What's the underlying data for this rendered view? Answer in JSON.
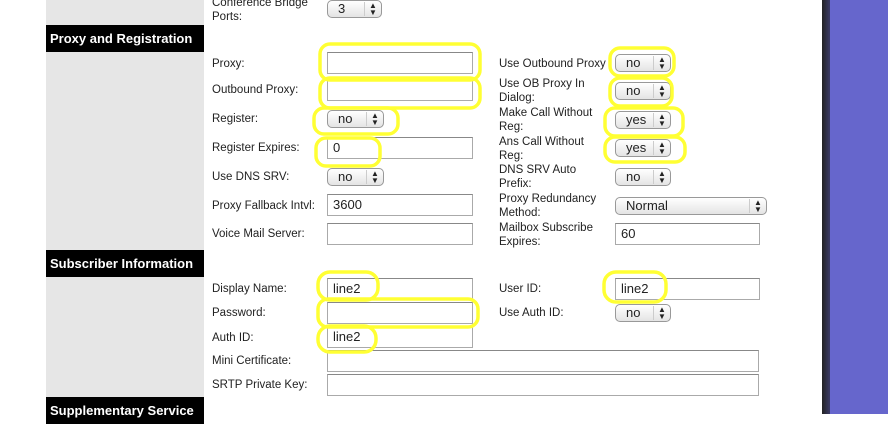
{
  "sections": {
    "proxy": "Proxy and Registration",
    "subscriber": "Subscriber Information",
    "supplementary": "Supplementary Service"
  },
  "fields": {
    "conf_bridge": {
      "label": "Conference Bridge Ports:",
      "value": "3"
    },
    "proxy": {
      "label": "Proxy:",
      "value": ""
    },
    "outbound_proxy": {
      "label": "Outbound Proxy:",
      "value": ""
    },
    "register": {
      "label": "Register:",
      "value": "no"
    },
    "register_expires": {
      "label": "Register Expires:",
      "value": "0"
    },
    "use_dns_srv": {
      "label": "Use DNS SRV:",
      "value": "no"
    },
    "proxy_fallback": {
      "label": "Proxy Fallback Intvl:",
      "value": "3600"
    },
    "voice_mail": {
      "label": "Voice Mail Server:",
      "value": ""
    },
    "use_outbound_proxy": {
      "label": "Use Outbound Proxy",
      "value": "no"
    },
    "use_ob_dialog": {
      "label": "Use OB Proxy In Dialog:",
      "value": "no"
    },
    "make_call": {
      "label": "Make Call Without Reg:",
      "value": "yes"
    },
    "ans_call": {
      "label": "Ans Call Without Reg:",
      "value": "yes"
    },
    "dns_srv_prefix": {
      "label": "DNS SRV Auto Prefix:",
      "value": "no"
    },
    "proxy_redundancy": {
      "label": "Proxy Redundancy Method:",
      "value": "Normal"
    },
    "mailbox_expires": {
      "label": "Mailbox Subscribe Expires:",
      "value": "60"
    },
    "display_name": {
      "label": "Display Name:",
      "value": "line2"
    },
    "password": {
      "label": "Password:",
      "value": ""
    },
    "auth_id": {
      "label": "Auth ID:",
      "value": "line2"
    },
    "mini_cert": {
      "label": "Mini Certificate:",
      "value": ""
    },
    "srtp_key": {
      "label": "SRTP Private Key:",
      "value": ""
    },
    "user_id": {
      "label": "User ID:",
      "value": "line2"
    },
    "use_auth_id": {
      "label": "Use Auth ID:",
      "value": "no"
    }
  },
  "colors": {
    "highlight": "#ffff33",
    "purple": "#6666cc"
  }
}
